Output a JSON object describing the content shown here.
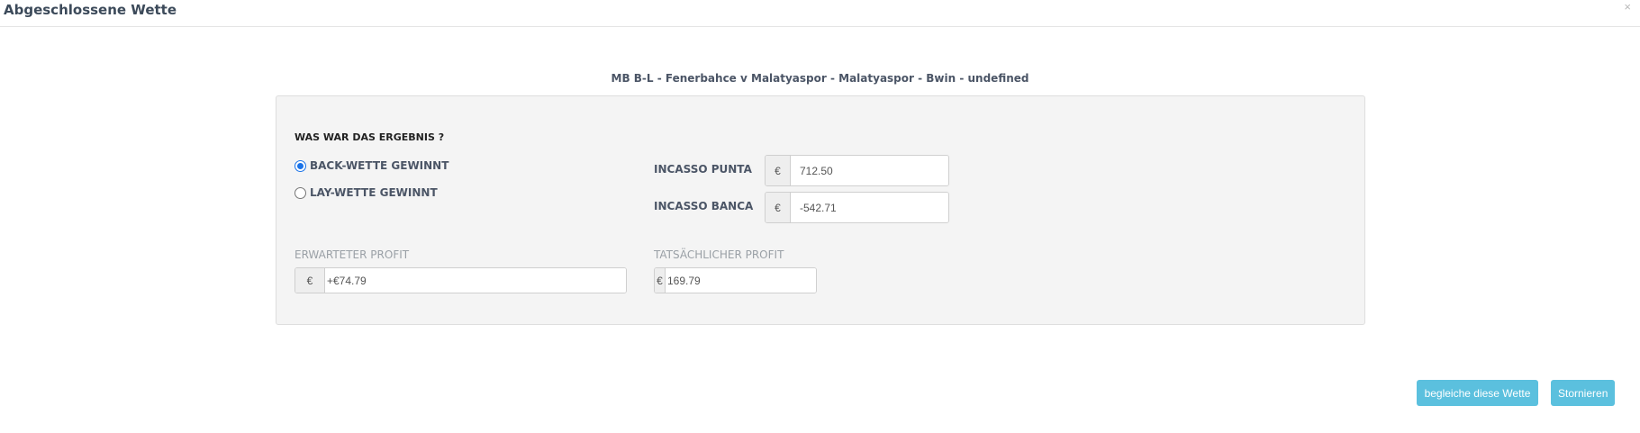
{
  "modal": {
    "title": "Abgeschlossene Wette",
    "close_label": "×"
  },
  "bet": {
    "title": "MB B-L - Fenerbahce v Malatyaspor - Malatyaspor - Bwin - undefined"
  },
  "result": {
    "question": "WAS WAR DAS ERGEBNIS ?",
    "options": [
      {
        "label": "BACK-WETTE GEWINNT",
        "checked": true
      },
      {
        "label": "LAY-WETTE GEWINNT",
        "checked": false
      }
    ]
  },
  "incasso": {
    "punta_label": "INCASSO PUNTA",
    "punta_value": "712.50",
    "banca_label": "INCASSO BANCA",
    "banca_value": "-542.71"
  },
  "profit": {
    "expected_label": "ERWARTETER PROFIT",
    "expected_value": "+€74.79",
    "actual_label": "TATSÄCHLICHER PROFIT",
    "actual_value": "169.79"
  },
  "currency_symbol": "€",
  "buttons": {
    "settle": "begleiche diese Wette",
    "cancel": "Stornieren"
  },
  "colors": {
    "button_bg": "#5bc0de",
    "radio_accent": "#1a73e8",
    "panel_bg": "#f4f4f4"
  }
}
